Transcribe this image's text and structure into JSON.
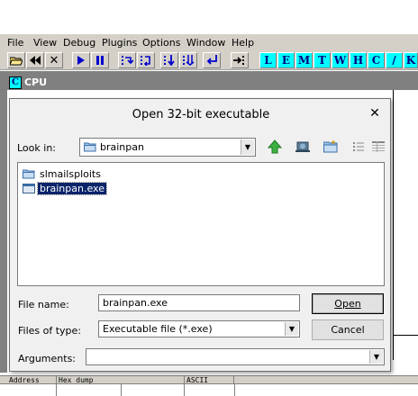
{
  "menu": [
    "File",
    "View",
    "Debug",
    "Plugins",
    "Options",
    "Window",
    "Help"
  ],
  "toolbar": {
    "letters": [
      "L",
      "E",
      "M",
      "T",
      "W",
      "H",
      "C",
      "/",
      "K"
    ]
  },
  "cpu_window": {
    "icon_letter": "C",
    "title": "CPU"
  },
  "dump": {
    "columns": [
      "Address",
      "Hex dump",
      "ASCII"
    ]
  },
  "dialog": {
    "title": "Open 32-bit executable",
    "close_glyph": "✕",
    "look_in_label": "Look in:",
    "look_in_value": "brainpan",
    "files": [
      {
        "name": "slmailsploits",
        "type": "folder",
        "selected": false
      },
      {
        "name": "brainpan.exe",
        "type": "file",
        "selected": true
      }
    ],
    "file_name_label": "File name:",
    "file_name_value": "brainpan.exe",
    "files_of_type_label": "Files of type:",
    "files_of_type_value": "Executable file (*.exe)",
    "arguments_label": "Arguments:",
    "arguments_value": "",
    "open_button": "Open",
    "cancel_button": "Cancel"
  },
  "colors": {
    "toolbar_letter_bg": "#00ffff",
    "toolbar_letter_fg": "#000080",
    "selection": "#0a246a",
    "workspace": "#808080"
  }
}
